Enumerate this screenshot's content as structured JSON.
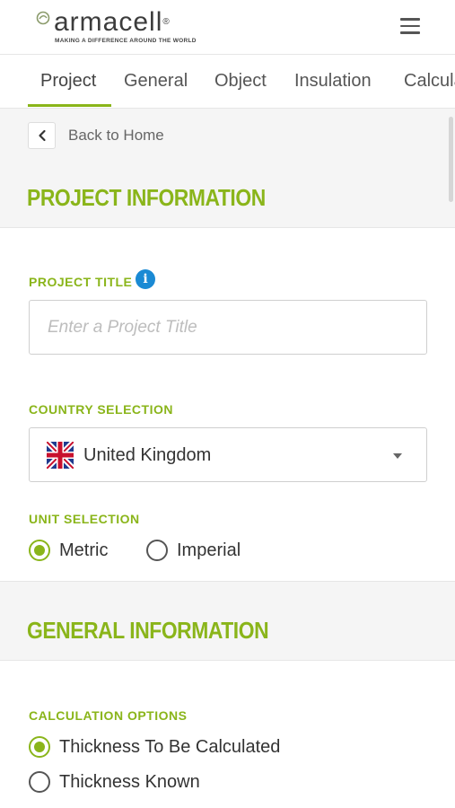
{
  "header": {
    "logo_text": "armacell",
    "logo_reg": "®",
    "logo_tagline": "MAKING A DIFFERENCE AROUND THE WORLD",
    "menu_icon": "hamburger-menu-icon"
  },
  "tabs": [
    {
      "label": "Project",
      "active": true
    },
    {
      "label": "General",
      "active": false
    },
    {
      "label": "Object",
      "active": false
    },
    {
      "label": "Insulation",
      "active": false
    },
    {
      "label": "Calcula",
      "active": false
    }
  ],
  "nav": {
    "back_label": "Back to Home",
    "back_icon": "chevron-left-icon"
  },
  "project_info": {
    "title": "PROJECT INFORMATION",
    "project_title_label": "PROJECT TITLE",
    "info_icon": "info-icon",
    "project_title_placeholder": "Enter a Project Title",
    "project_title_value": "",
    "country_label": "COUNTRY SELECTION",
    "country_value": "United Kingdom",
    "country_flag": "uk-flag-icon",
    "unit_label": "UNIT SELECTION",
    "unit_options": [
      {
        "label": "Metric",
        "checked": true
      },
      {
        "label": "Imperial",
        "checked": false
      }
    ]
  },
  "general_info": {
    "title": "GENERAL INFORMATION",
    "calc_label": "CALCULATION OPTIONS",
    "calc_options": [
      {
        "label": "Thickness To Be Calculated",
        "checked": true
      },
      {
        "label": "Thickness Known",
        "checked": false
      }
    ]
  },
  "colors": {
    "accent": "#8ab51a",
    "info": "#1a8ad4",
    "text": "#333333",
    "background": "#f5f5f5"
  }
}
